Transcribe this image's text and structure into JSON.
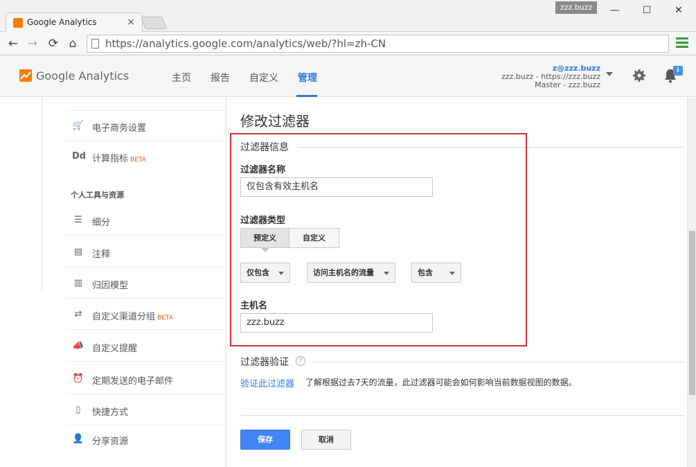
{
  "browser": {
    "tab_title": "Google Analytics",
    "tab_close": "×",
    "profile": "zzz.buzz",
    "url": "https://analytics.google.com/analytics/web/?hl=zh-CN",
    "win_min": "—",
    "win_max": "☐",
    "win_close": "✕",
    "back": "←",
    "forward": "→",
    "reload": "⟳",
    "home": "⌂"
  },
  "ga": {
    "logo_text": "Google Analytics",
    "nav": [
      "主页",
      "报告",
      "自定义",
      "管理"
    ],
    "active_nav": "管理",
    "account_email": "z@zzz.buzz",
    "account_property": "zzz.buzz - https://zzz.buzz",
    "account_view": "Master - zzz.buzz",
    "notification_badge": "i",
    "accent_color": "#2b7bd6"
  },
  "sidebar": {
    "items_top": [
      {
        "label": "电子商务设置",
        "icon": "cart-icon",
        "glyph": "🛒"
      },
      {
        "label": "计算指标",
        "icon": "dd-icon",
        "glyph": "Dd",
        "badge": "BETA"
      }
    ],
    "section_title": "个人工具与资源",
    "items": [
      {
        "label": "细分",
        "icon": "segments-icon",
        "glyph": "☰"
      },
      {
        "label": "注释",
        "icon": "annotation-icon",
        "glyph": "▤"
      },
      {
        "label": "归因模型",
        "icon": "attribution-icon",
        "glyph": "▥"
      },
      {
        "label": "自定义渠道分组",
        "icon": "channel-icon",
        "glyph": "⇄",
        "badge": "BETA"
      },
      {
        "label": "自定义提醒",
        "icon": "megaphone-icon",
        "glyph": "📣"
      },
      {
        "label": "定期发送的电子邮件",
        "icon": "alarm-icon",
        "glyph": "⏰"
      },
      {
        "label": "快捷方式",
        "icon": "document-icon",
        "glyph": "▯"
      },
      {
        "label": "分享资源",
        "icon": "add-user-icon",
        "glyph": "👤"
      }
    ]
  },
  "main": {
    "title": "修改过滤器",
    "info_section": "过滤器信息",
    "name_label": "过滤器名称",
    "name_value": "仅包含有效主机名",
    "type_label": "过滤器类型",
    "type_predefined": "预定义",
    "type_custom": "自定义",
    "select_include": "仅包含",
    "select_source": "访问主机名的流量",
    "select_match": "包含",
    "hostname_label": "主机名",
    "hostname_value": "zzz.buzz",
    "verify_title": "过滤器验证",
    "verify_help": "?",
    "verify_link": "验证此过滤器",
    "verify_desc": "了解根据过去7天的流量，此过滤器可能会如何影响当前数据视图的数据。",
    "save": "保存",
    "cancel": "取消",
    "highlight_color": "#d32f2f",
    "save_color": "#4285f4"
  }
}
